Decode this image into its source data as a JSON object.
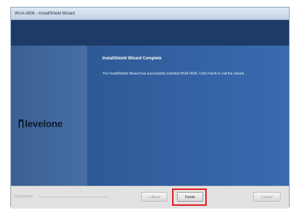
{
  "window": {
    "title": "WUA-0606 - InstallShield Wizard"
  },
  "main": {
    "heading": "InstallShield Wizard Complete",
    "message": "The InstallShield Wizard has successfully installed WUA-0606. Click Finish to exit the wizard."
  },
  "branding": {
    "logo_text": "levelone"
  },
  "footer": {
    "brand_text": "InstallShield",
    "back_label": "< Back",
    "finish_label": "Finish",
    "cancel_label": "Cancel"
  },
  "colors": {
    "highlight": "#e1141b",
    "banner": "#1d3b68",
    "content": "#3a6ab0"
  }
}
